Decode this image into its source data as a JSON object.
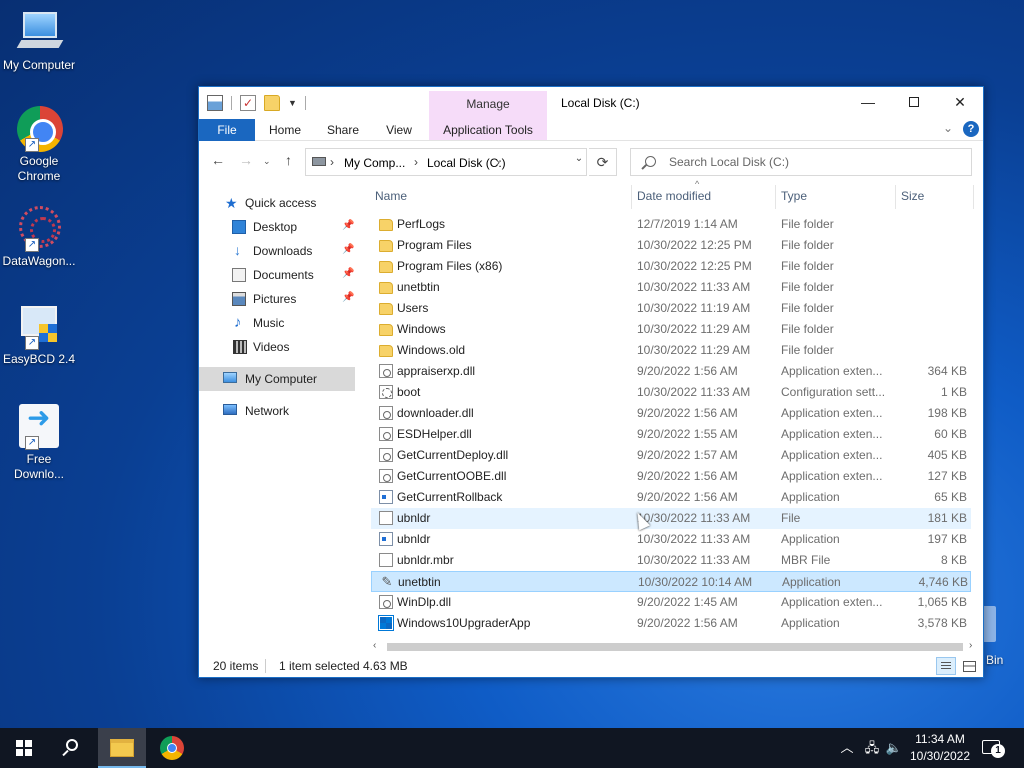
{
  "desktop": {
    "icons": [
      {
        "label": "My Computer",
        "icon": "computer-icon"
      },
      {
        "label": "Google Chrome",
        "icon": "chrome-icon"
      },
      {
        "label": "DataWagon...",
        "icon": "datawagon-icon"
      },
      {
        "label": "EasyBCD 2.4",
        "icon": "easybcd-icon"
      },
      {
        "label": "Free Downlo...",
        "icon": "free-download-manager-icon"
      }
    ],
    "recycle_bin_label": "Bin"
  },
  "window": {
    "title": "Local Disk (C:)",
    "contextual_tab_header": "Manage",
    "ribbon_tabs": [
      "File",
      "Home",
      "Share",
      "View",
      "Application Tools"
    ],
    "address": {
      "crumbs": [
        "My Comp...",
        "Local Disk (C:)"
      ]
    },
    "search_placeholder": "Search Local Disk (C:)",
    "nav": {
      "quick_access": "Quick access",
      "items": [
        {
          "label": "Desktop",
          "pinned": true
        },
        {
          "label": "Downloads",
          "pinned": true
        },
        {
          "label": "Documents",
          "pinned": true
        },
        {
          "label": "Pictures",
          "pinned": true
        },
        {
          "label": "Music",
          "pinned": false
        },
        {
          "label": "Videos",
          "pinned": false
        }
      ],
      "my_computer": "My Computer",
      "network": "Network"
    },
    "columns": {
      "name": "Name",
      "date": "Date modified",
      "type": "Type",
      "size": "Size"
    },
    "files": [
      {
        "name": "PerfLogs",
        "date": "12/7/2019 1:14 AM",
        "type": "File folder",
        "size": "",
        "icon": "folder"
      },
      {
        "name": "Program Files",
        "date": "10/30/2022 12:25 PM",
        "type": "File folder",
        "size": "",
        "icon": "folder"
      },
      {
        "name": "Program Files (x86)",
        "date": "10/30/2022 12:25 PM",
        "type": "File folder",
        "size": "",
        "icon": "folder"
      },
      {
        "name": "unetbtin",
        "date": "10/30/2022 11:33 AM",
        "type": "File folder",
        "size": "",
        "icon": "folder"
      },
      {
        "name": "Users",
        "date": "10/30/2022 11:19 AM",
        "type": "File folder",
        "size": "",
        "icon": "folder"
      },
      {
        "name": "Windows",
        "date": "10/30/2022 11:29 AM",
        "type": "File folder",
        "size": "",
        "icon": "folder"
      },
      {
        "name": "Windows.old",
        "date": "10/30/2022 11:29 AM",
        "type": "File folder",
        "size": "",
        "icon": "folder"
      },
      {
        "name": "appraiserxp.dll",
        "date": "9/20/2022 1:56 AM",
        "type": "Application exten...",
        "size": "364 KB",
        "icon": "dll"
      },
      {
        "name": "boot",
        "date": "10/30/2022 11:33 AM",
        "type": "Configuration sett...",
        "size": "1 KB",
        "icon": "settings"
      },
      {
        "name": "downloader.dll",
        "date": "9/20/2022 1:56 AM",
        "type": "Application exten...",
        "size": "198 KB",
        "icon": "dll"
      },
      {
        "name": "ESDHelper.dll",
        "date": "9/20/2022 1:55 AM",
        "type": "Application exten...",
        "size": "60 KB",
        "icon": "dll"
      },
      {
        "name": "GetCurrentDeploy.dll",
        "date": "9/20/2022 1:57 AM",
        "type": "Application exten...",
        "size": "405 KB",
        "icon": "dll"
      },
      {
        "name": "GetCurrentOOBE.dll",
        "date": "9/20/2022 1:56 AM",
        "type": "Application exten...",
        "size": "127 KB",
        "icon": "dll"
      },
      {
        "name": "GetCurrentRollback",
        "date": "9/20/2022 1:56 AM",
        "type": "Application",
        "size": "65 KB",
        "icon": "app"
      },
      {
        "name": "ubnldr",
        "date": "10/30/2022 11:33 AM",
        "type": "File",
        "size": "181 KB",
        "icon": "file",
        "state": "hover"
      },
      {
        "name": "ubnldr",
        "date": "10/30/2022 11:33 AM",
        "type": "Application",
        "size": "197 KB",
        "icon": "app"
      },
      {
        "name": "ubnldr.mbr",
        "date": "10/30/2022 11:33 AM",
        "type": "MBR File",
        "size": "8 KB",
        "icon": "file"
      },
      {
        "name": "unetbtin",
        "date": "10/30/2022 10:14 AM",
        "type": "Application",
        "size": "4,746 KB",
        "icon": "unetbootin",
        "state": "selected"
      },
      {
        "name": "WinDlp.dll",
        "date": "9/20/2022 1:45 AM",
        "type": "Application exten...",
        "size": "1,065 KB",
        "icon": "dll"
      },
      {
        "name": "Windows10UpgraderApp",
        "date": "9/20/2022 1:56 AM",
        "type": "Application",
        "size": "3,578 KB",
        "icon": "win10"
      }
    ],
    "status": {
      "count": "20 items",
      "selected": "1 item selected",
      "size": "4.63 MB"
    }
  },
  "taskbar": {
    "time": "11:34 AM",
    "date": "10/30/2022",
    "notification_count": "1"
  }
}
